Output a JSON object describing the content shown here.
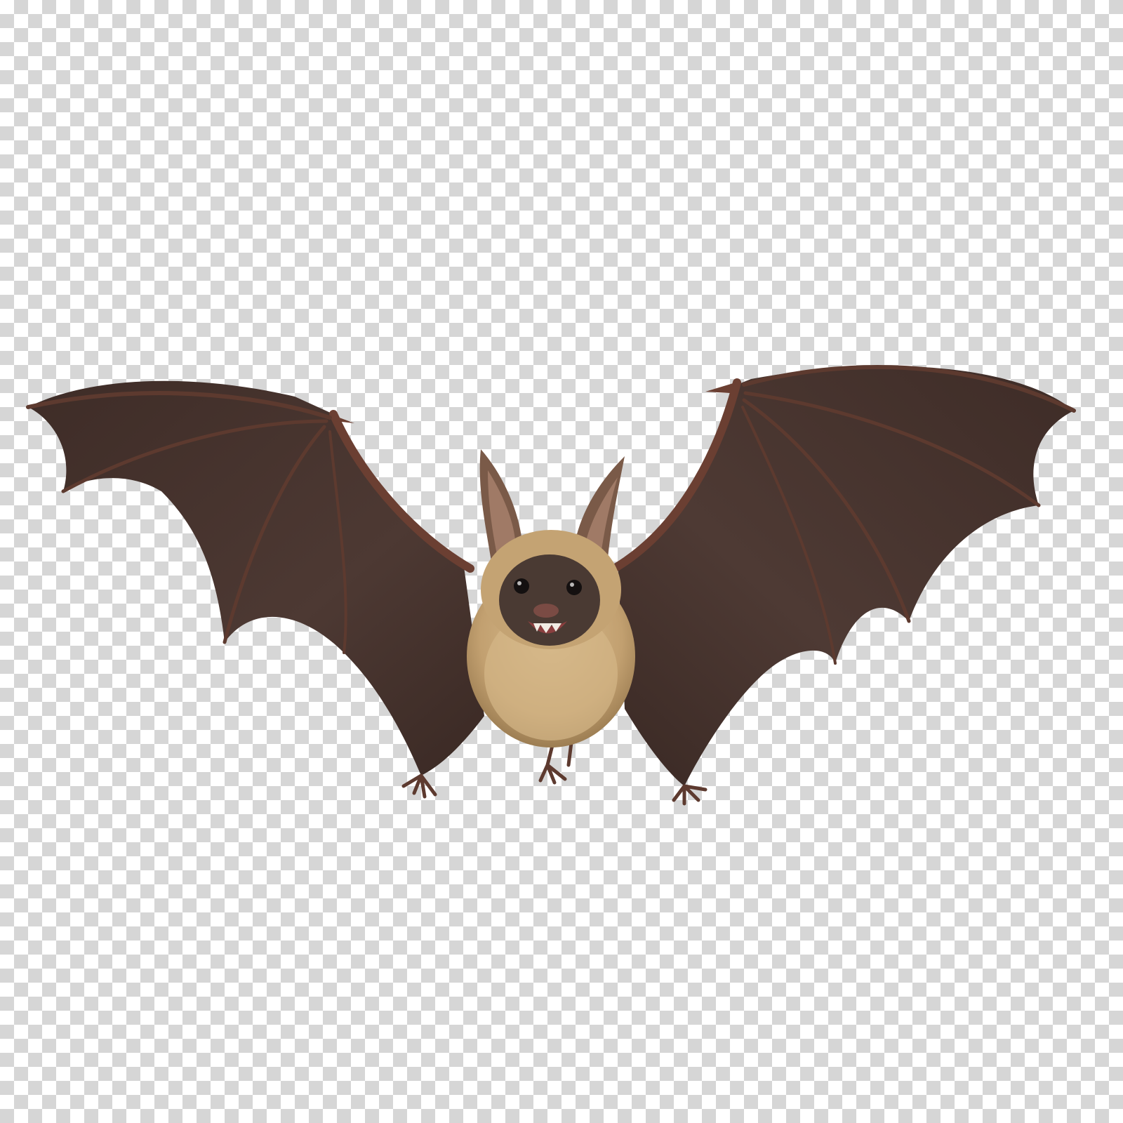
{
  "scene": {
    "subject": "bat",
    "background": "transparency-checkerboard"
  },
  "colors": {
    "checker_light": "#ffffff",
    "checker_dark": "#d6d6d6",
    "wing_membrane": "#4a3630",
    "wing_membrane_dark": "#3b2a25",
    "wing_bone": "#6b3f32",
    "fur": "#c9a97a",
    "fur_shadow": "#a98a5e",
    "face": "#4a3a33",
    "ear": "#7a5a48",
    "ear_inner": "#a07a66",
    "mouth": "#8a3f3f",
    "teeth": "#f2ece4",
    "eye": "#141010"
  }
}
